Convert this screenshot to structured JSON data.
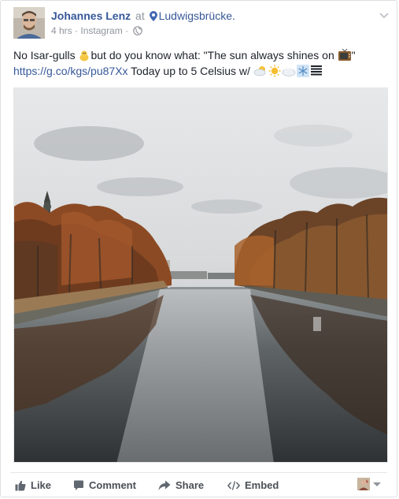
{
  "post": {
    "author": "Johannes Lenz",
    "at_text": "at",
    "place": "Ludwigsbrücke.",
    "time": "4 hrs",
    "separator": "·",
    "source": "Instagram",
    "separator2": "·",
    "text_part1": "No Isar-gulls ",
    "text_part2": "but do you know what: \"The sun always shines on ",
    "text_part3": "\"",
    "link": "https://g.co/kgs/pu87Xx",
    "text_part4": " Today up to 5 Celsius w/ "
  },
  "actions": {
    "like": "Like",
    "comment": "Comment",
    "share": "Share",
    "embed": "Embed"
  },
  "icons": {
    "chick": "baby-chick-emoji",
    "tv": "television-emoji",
    "weather": [
      "sun-behind-cloud-emoji",
      "sun-emoji",
      "cloud-emoji",
      "snowflake-emoji",
      "fog-emoji"
    ]
  },
  "colors": {
    "link": "#365899",
    "muted": "#90949c",
    "action_text": "#4b4f56"
  }
}
